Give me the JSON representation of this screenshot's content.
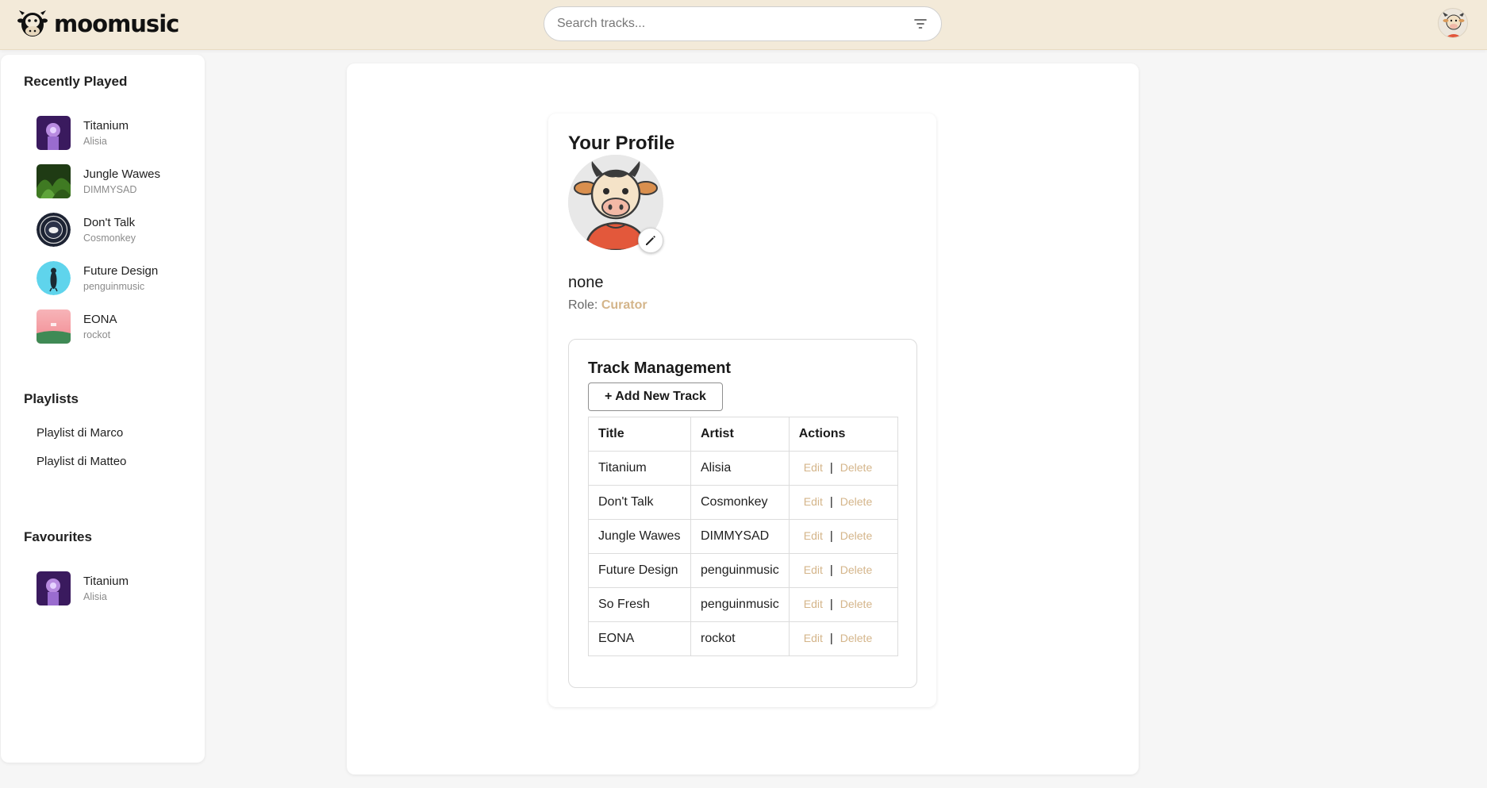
{
  "app": {
    "name": "moomusic"
  },
  "search": {
    "placeholder": "Search tracks..."
  },
  "sidebar": {
    "recent_heading": "Recently Played",
    "recent": [
      {
        "title": "Titanium",
        "artist": "Alisia"
      },
      {
        "title": "Jungle Wawes",
        "artist": "DIMMYSAD"
      },
      {
        "title": "Don't Talk",
        "artist": "Cosmonkey"
      },
      {
        "title": "Future Design",
        "artist": "penguinmusic"
      },
      {
        "title": "EONA",
        "artist": "rockot"
      }
    ],
    "playlists_heading": "Playlists",
    "playlists": [
      "Playlist di Marco",
      "Playlist di Matteo"
    ],
    "favourites_heading": "Favourites",
    "favourites": [
      {
        "title": "Titanium",
        "artist": "Alisia"
      }
    ]
  },
  "profile": {
    "title": "Your Profile",
    "username": "none",
    "role_label": "Role:",
    "role_value": "Curator"
  },
  "track_management": {
    "title": "Track Management",
    "add_button": "+ Add New Track",
    "columns": [
      "Title",
      "Artist",
      "Actions"
    ],
    "edit_label": "Edit",
    "separator": "|",
    "delete_label": "Delete",
    "rows": [
      {
        "title": "Titanium",
        "artist": "Alisia"
      },
      {
        "title": "Don't Talk",
        "artist": "Cosmonkey"
      },
      {
        "title": "Jungle Wawes",
        "artist": "DIMMYSAD"
      },
      {
        "title": "Future Design",
        "artist": "penguinmusic"
      },
      {
        "title": "So Fresh",
        "artist": "penguinmusic"
      },
      {
        "title": "EONA",
        "artist": "rockot"
      }
    ]
  },
  "colors": {
    "header_bg": "#f3ead9",
    "accent": "#d4b58a",
    "page_bg": "#f6f6f6"
  },
  "icons": {
    "logo": "cow-logo-icon",
    "filter": "filter-icon",
    "edit": "pencil-icon",
    "user": "user-avatar-icon"
  }
}
